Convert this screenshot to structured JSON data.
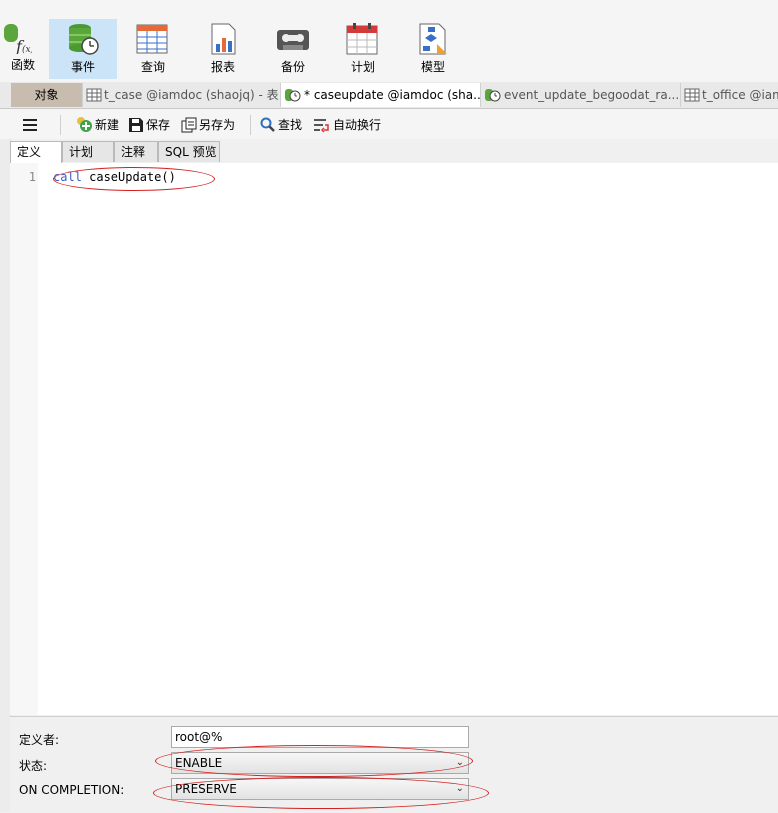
{
  "ribbon": {
    "items": [
      {
        "label": "函数",
        "icon": "function-icon"
      },
      {
        "label": "事件",
        "icon": "event-icon"
      },
      {
        "label": "查询",
        "icon": "query-icon"
      },
      {
        "label": "报表",
        "icon": "report-icon"
      },
      {
        "label": "备份",
        "icon": "backup-icon"
      },
      {
        "label": "计划",
        "icon": "schedule-icon"
      },
      {
        "label": "模型",
        "icon": "model-icon"
      }
    ]
  },
  "object_tabs": {
    "objects": "对象",
    "tabs": [
      {
        "label": "t_case @iamdoc (shaojq) - 表"
      },
      {
        "label": "* caseupdate @iamdoc (sha..."
      },
      {
        "label": "event_update_begoodat_ra..."
      },
      {
        "label": "t_office @iam"
      }
    ]
  },
  "toolbar": {
    "new_label": "新建",
    "save_label": "保存",
    "saveas_label": "另存为",
    "find_label": "查找",
    "wrap_label": "自动换行"
  },
  "subtabs": [
    "定义",
    "计划",
    "注释",
    "SQL 预览"
  ],
  "editor": {
    "line_number": "1",
    "code_keyword": "call",
    "code_rest": " caseUpdate()"
  },
  "properties": {
    "definer_label": "定义者:",
    "definer_value": "root@%",
    "status_label": "状态:",
    "status_value": "ENABLE",
    "completion_label": "ON COMPLETION:",
    "completion_value": "PRESERVE"
  }
}
